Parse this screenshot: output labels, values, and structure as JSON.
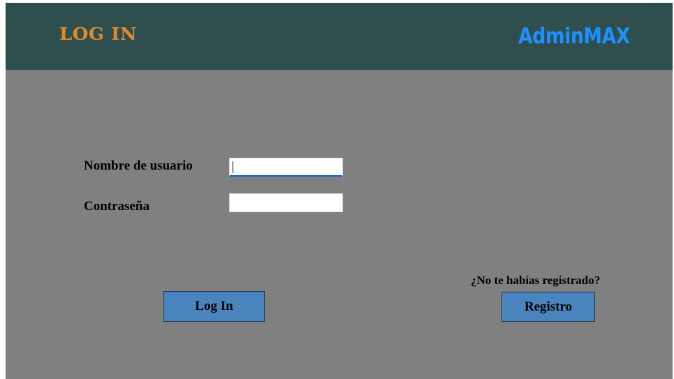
{
  "header": {
    "title": "LOG IN",
    "brand": "AdminMAX"
  },
  "form": {
    "username_label": "Nombre de usuario",
    "username_value": "",
    "password_label": "Contraseña",
    "password_value": ""
  },
  "actions": {
    "login_label": "Log In",
    "register_hint": "¿No te habías registrado?",
    "register_label": "Registro"
  },
  "colors": {
    "header_bg": "#2f4f4f",
    "body_bg": "#808080",
    "title_color": "#e08a2e",
    "brand_color": "#1e90ff",
    "button_bg": "#4a84be",
    "focus_underline": "#0a64c8"
  }
}
